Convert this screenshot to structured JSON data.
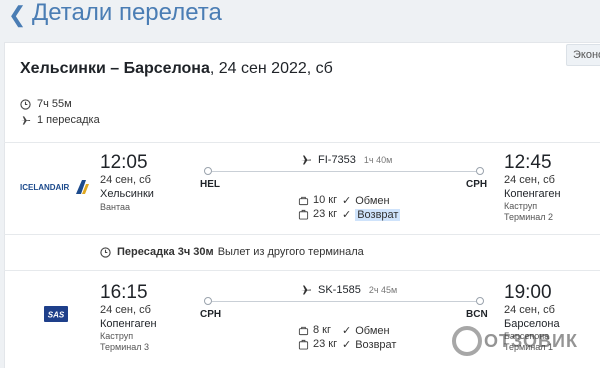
{
  "header": {
    "title": "Детали перелета",
    "back_icon": "chevron-left-icon"
  },
  "card": {
    "class_badge": "Эконо",
    "route": {
      "cities": "Хельсинки – Барселона",
      "date": ", 24 сен 2022, сб"
    },
    "total_duration": "7ч 55м",
    "stops": "1 пересадка"
  },
  "segments": [
    {
      "airline": "ICELANDAIR",
      "dep_time": "12:05",
      "dep_date": "24 сен, сб",
      "dep_city": "Хельсинки",
      "dep_airport": "Вантаа",
      "dep_terminal": "",
      "arr_time": "12:45",
      "arr_date": "24 сен, сб",
      "arr_city": "Копенгаген",
      "arr_airport": "Каструп",
      "arr_terminal": "Терминал 2",
      "dep_code": "HEL",
      "arr_code": "CPH",
      "flight_no": "FI-7353",
      "duration": "1ч 40м",
      "cabin_bag": "10 кг",
      "checked_bag": "23 кг",
      "exchange": "Обмен",
      "refund": "Возврат"
    },
    {
      "airline": "SAS",
      "dep_time": "16:15",
      "dep_date": "24 сен, сб",
      "dep_city": "Копенгаген",
      "dep_airport": "Каструп",
      "dep_terminal": "Терминал 3",
      "arr_time": "19:00",
      "arr_date": "24 сен, сб",
      "arr_city": "Барселона",
      "arr_airport": "Барсепона",
      "arr_terminal": "Терминал 1",
      "dep_code": "CPH",
      "arr_code": "BCN",
      "flight_no": "SK-1585",
      "duration": "2ч 45м",
      "cabin_bag": "8 кг",
      "checked_bag": "23 кг",
      "exchange": "Обмен",
      "refund": "Возврат"
    }
  ],
  "transfer": {
    "label": "Пересадка 3ч 30м",
    "note": "Вылет из другого терминала"
  },
  "watermark": "ОТЗОВИК",
  "colors": {
    "accent": "#4a7db4",
    "highlight": "#cfe3fb",
    "icelandair": "#1c4a8c",
    "sas": "#1e3f8a"
  }
}
